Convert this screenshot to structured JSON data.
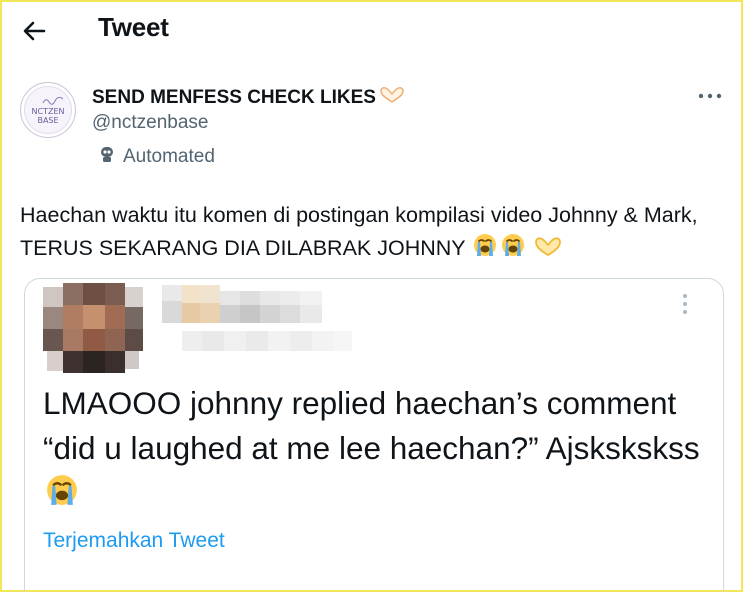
{
  "header": {
    "title": "Tweet",
    "back_icon": "arrow-left-icon"
  },
  "author": {
    "display_name": "SEND MENFESS CHECK LIKES",
    "name_emoji": "heart-hands-icon",
    "username": "@nctzenbase",
    "label": "Automated",
    "label_icon": "bot-icon",
    "avatar_text": "NCTZEN BASE"
  },
  "tweet": {
    "text": "Haechan waktu itu komen di postingan kompilasi video Johnny & Mark, TERUS SEKARANG DIA DILABRAK JOHNNY",
    "trailing_emojis": [
      "loudly-crying-face-icon",
      "loudly-crying-face-icon",
      "heart-hands-icon"
    ]
  },
  "quoted": {
    "text": "LMAOOO johnny replied haechan’s comment “did u laughed at me lee haechan?” Ajskskskss",
    "trailing_emoji": "loudly-crying-face-icon",
    "translate_label": "Terjemahkan Tweet",
    "author_blurred": true
  },
  "colors": {
    "text": "#0f1419",
    "secondary": "#536471",
    "link": "#1d9bf0",
    "border": "#cfd9de",
    "frame": "#f2e65a"
  }
}
